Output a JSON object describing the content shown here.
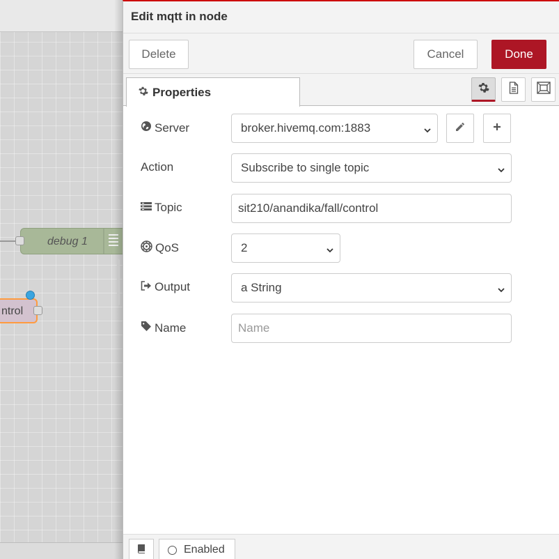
{
  "canvas": {
    "nodes": [
      {
        "label": "debug 1"
      },
      {
        "label": "ntrol"
      }
    ]
  },
  "tray": {
    "title": "Edit mqtt in node",
    "toolbar": {
      "delete_label": "Delete",
      "cancel_label": "Cancel",
      "done_label": "Done"
    },
    "tabs": {
      "properties_label": "Properties",
      "icons": [
        "gear-icon",
        "document-icon",
        "frame-icon"
      ]
    },
    "form": {
      "server": {
        "label": "Server",
        "value": "broker.hivemq.com:1883"
      },
      "action": {
        "label": "Action",
        "value": "Subscribe to single topic"
      },
      "topic": {
        "label": "Topic",
        "value": "sit210/anandika/fall/control"
      },
      "qos": {
        "label": "QoS",
        "value": "2"
      },
      "output": {
        "label": "Output",
        "value": "a String"
      },
      "name": {
        "label": "Name",
        "value": "",
        "placeholder": "Name"
      }
    },
    "footer": {
      "enabled_label": "Enabled"
    }
  },
  "colors": {
    "done_bg": "#ad1625",
    "canvas_bg": "#d5d5d5",
    "debug_node": "#a8b898",
    "selected_outline": "#ff9b3f",
    "status_dot": "#3aa5e0"
  }
}
